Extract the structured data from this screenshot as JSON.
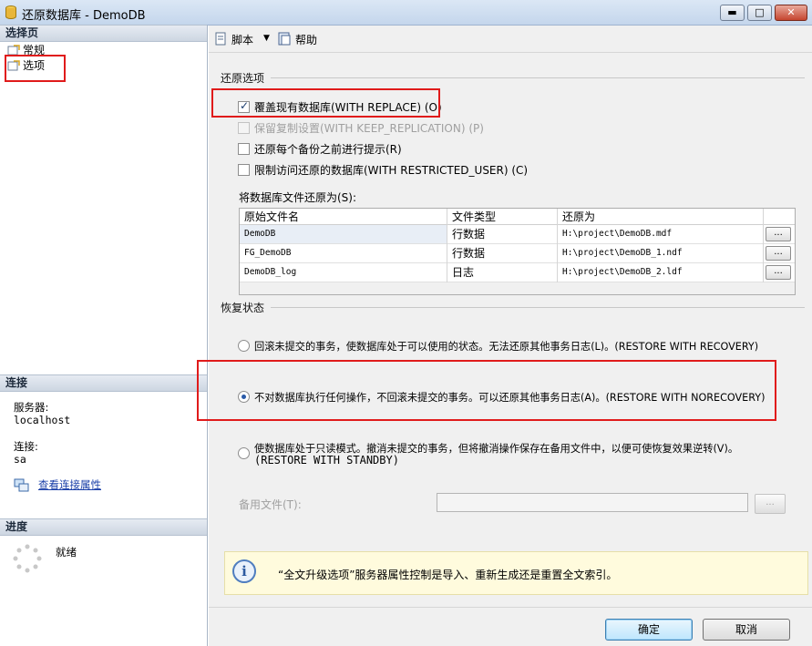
{
  "window": {
    "title": "还原数据库 - DemoDB",
    "controls": {
      "minimize": "▬",
      "maximize": "□",
      "close": "✕"
    }
  },
  "left": {
    "select_page_header": "选择页",
    "pages": [
      {
        "label": "常规",
        "icon": "page-icon"
      },
      {
        "label": "选项",
        "icon": "page-icon"
      }
    ],
    "connection_header": "连接",
    "server_label": "服务器:",
    "server_value": "localhost",
    "connection_label": "连接:",
    "connection_value": "sa",
    "view_connection_link": "查看连接属性",
    "progress_header": "进度",
    "progress_status": "就绪"
  },
  "toolbar": {
    "script": "脚本",
    "help": "帮助"
  },
  "restore_options": {
    "section": "还原选项",
    "options": [
      {
        "label": "覆盖现有数据库(WITH REPLACE) (O)",
        "checked": true,
        "enabled": true
      },
      {
        "label": "保留复制设置(WITH KEEP_REPLICATION) (P)",
        "checked": false,
        "enabled": false
      },
      {
        "label": "还原每个备份之前进行提示(R)",
        "checked": false,
        "enabled": true
      },
      {
        "label": "限制访问还原的数据库(WITH RESTRICTED_USER) (C)",
        "checked": false,
        "enabled": true
      }
    ],
    "files_label": "将数据库文件还原为(S):",
    "grid": {
      "headers": [
        "原始文件名",
        "文件类型",
        "还原为"
      ],
      "rows": [
        {
          "name": "DemoDB",
          "type": "行数据",
          "restore_as": "H:\\project\\DemoDB.mdf",
          "browse": "..."
        },
        {
          "name": "FG_DemoDB",
          "type": "行数据",
          "restore_as": "H:\\project\\DemoDB_1.ndf",
          "browse": "..."
        },
        {
          "name": "DemoDB_log",
          "type": "日志",
          "restore_as": "H:\\project\\DemoDB_2.ldf",
          "browse": "..."
        }
      ]
    }
  },
  "recovery_state": {
    "section": "恢复状态",
    "options": [
      {
        "label": "回滚未提交的事务，使数据库处于可以使用的状态。无法还原其他事务日志(L)。(RESTORE WITH RECOVERY)",
        "selected": false
      },
      {
        "label": "不对数据库执行任何操作，不回滚未提交的事务。可以还原其他事务日志(A)。(RESTORE WITH NORECOVERY)",
        "selected": true
      },
      {
        "label": "使数据库处于只读模式。撤消未提交的事务，但将撤消操作保存在备用文件中，以便可使恢复效果逆转(V)。",
        "label_line2": "(RESTORE WITH STANDBY)",
        "selected": false
      }
    ],
    "standby_file_label": "备用文件(T):",
    "standby_file_value": "",
    "standby_browse": "..."
  },
  "info": {
    "text": "“全文升级选项”服务器属性控制是导入、重新生成还是重置全文索引。",
    "icon": "info-icon"
  },
  "buttons": {
    "ok": "确定",
    "cancel": "取消"
  }
}
